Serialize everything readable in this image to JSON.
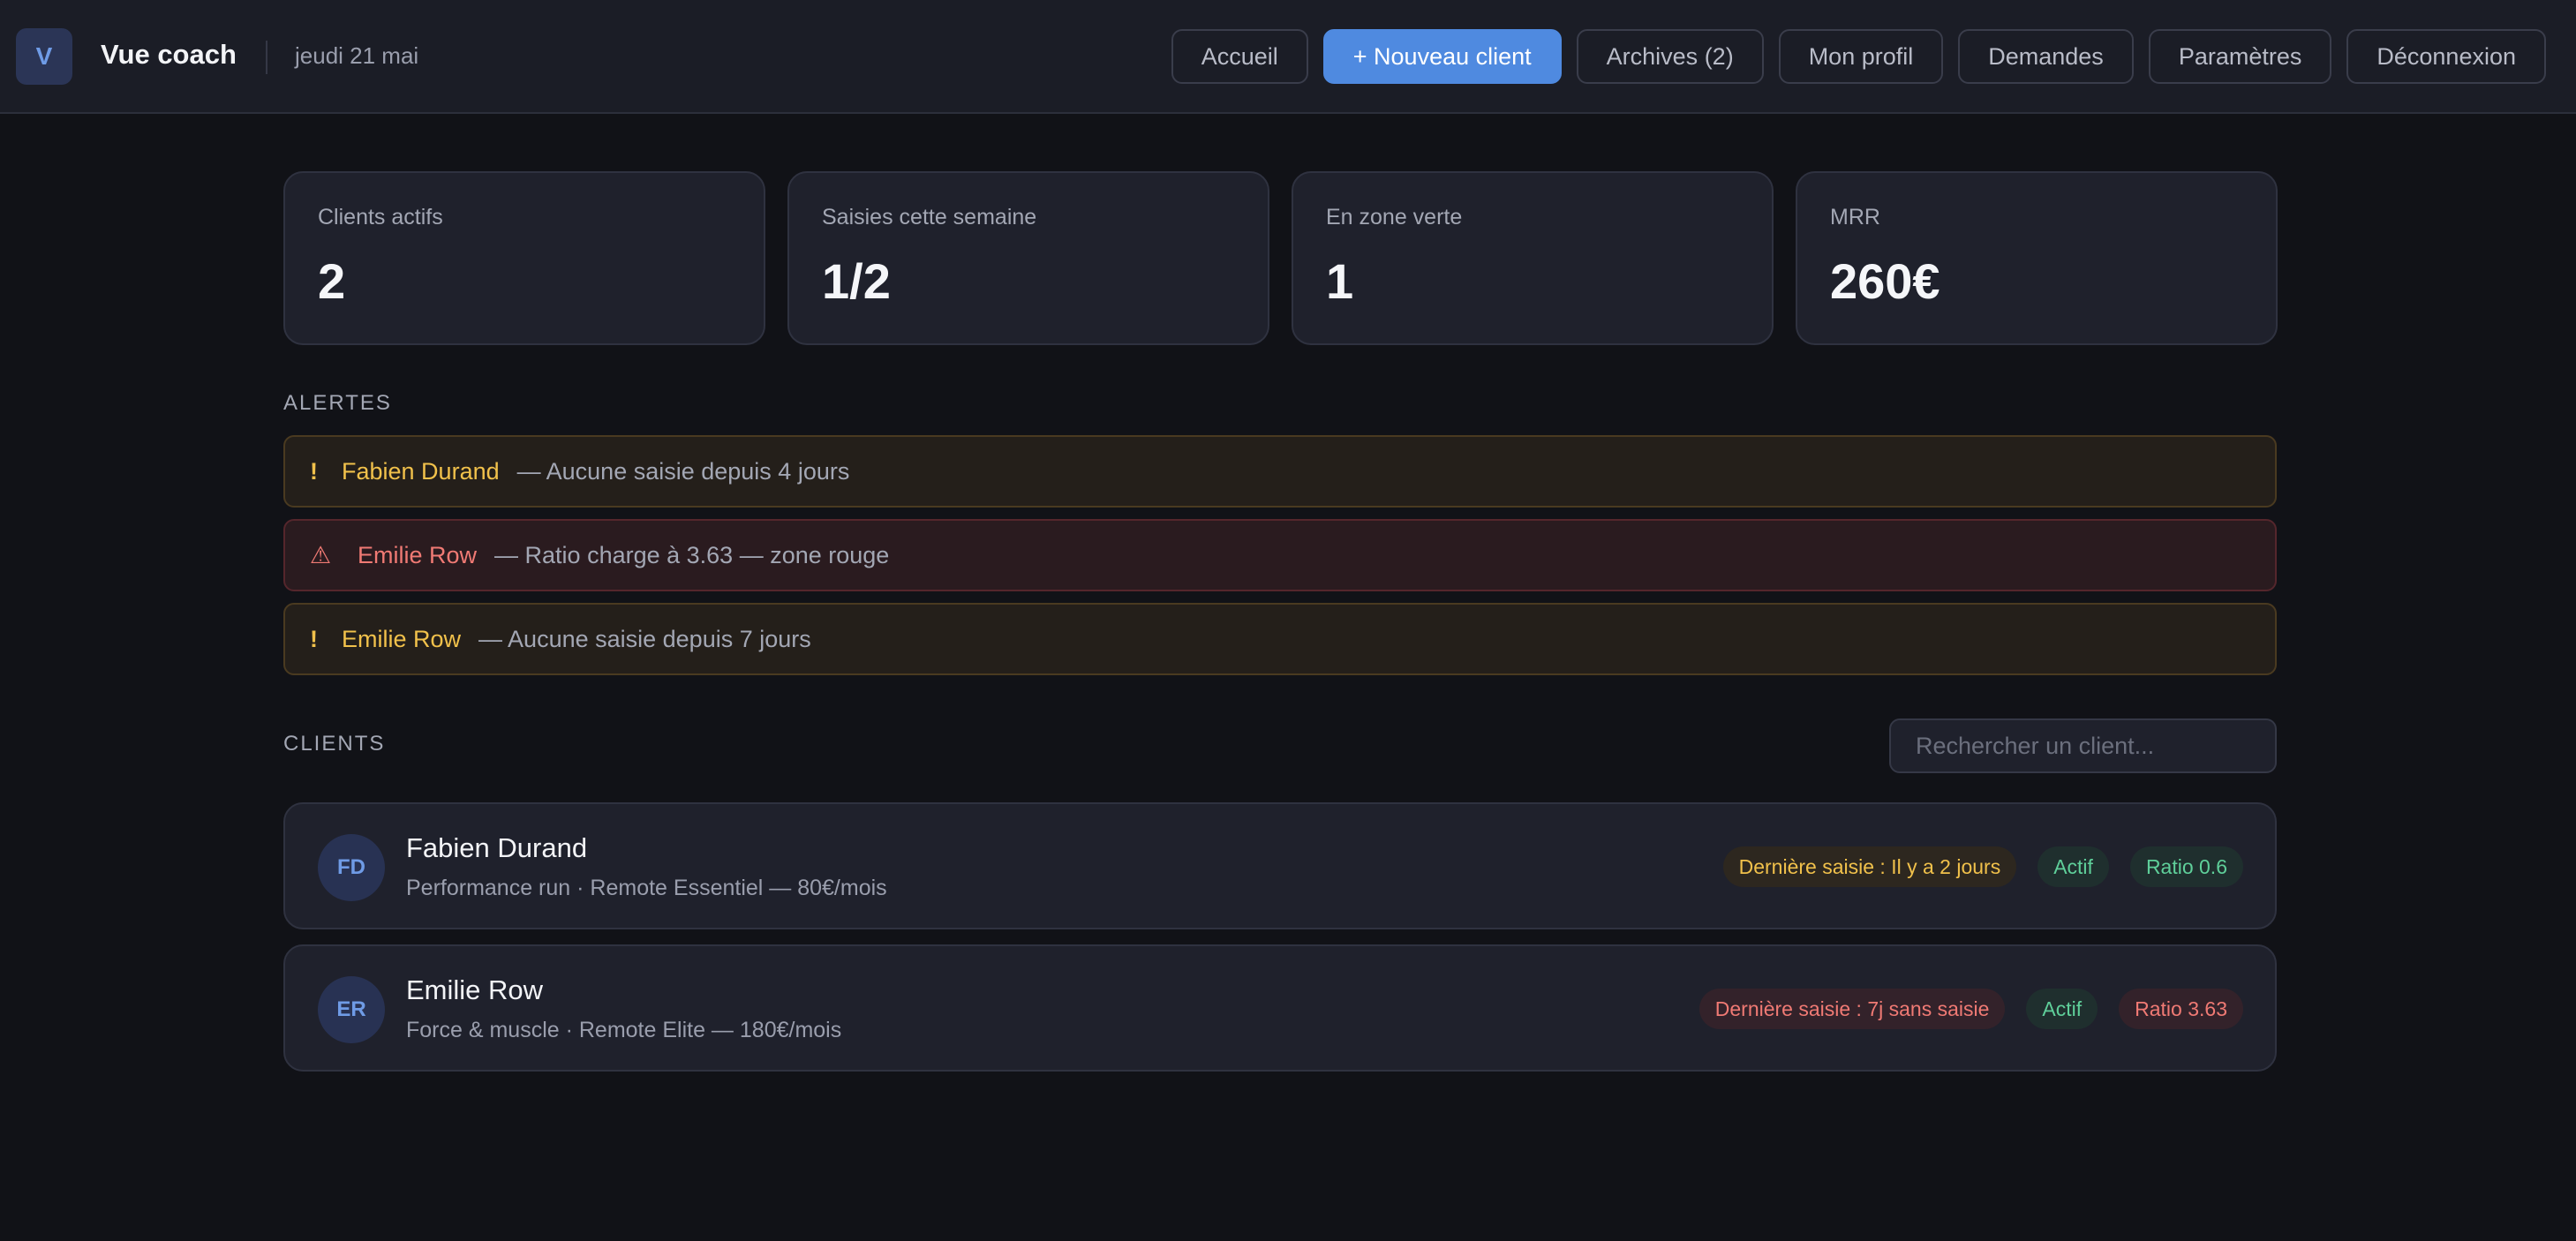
{
  "header": {
    "logo_letter": "V",
    "title": "Vue coach",
    "date": "jeudi 21 mai",
    "nav": [
      {
        "label": "Accueil"
      },
      {
        "label": "+ Nouveau client"
      },
      {
        "label": "Archives (2)"
      },
      {
        "label": "Mon profil"
      },
      {
        "label": "Demandes"
      },
      {
        "label": "Paramètres"
      },
      {
        "label": "Déconnexion"
      }
    ]
  },
  "stats": [
    {
      "label": "Clients actifs",
      "value": "2"
    },
    {
      "label": "Saisies cette semaine",
      "value": "1/2"
    },
    {
      "label": "En zone verte",
      "value": "1"
    },
    {
      "label": "MRR",
      "value": "260€"
    }
  ],
  "alerts": {
    "title": "ALERTES",
    "items": [
      {
        "severity": "warning",
        "icon": "!",
        "name": "Fabien Durand",
        "text": "— Aucune saisie depuis 4 jours"
      },
      {
        "severity": "danger",
        "icon": "⚠",
        "name": "Emilie Row",
        "text": "— Ratio charge à 3.63 — zone rouge"
      },
      {
        "severity": "warning",
        "icon": "!",
        "name": "Emilie Row",
        "text": "— Aucune saisie depuis 7 jours"
      }
    ]
  },
  "clients": {
    "title": "CLIENTS",
    "search_placeholder": "Rechercher un client...",
    "items": [
      {
        "initials": "FD",
        "name": "Fabien Durand",
        "subtitle": "Performance run · Remote Essentiel — 80€/mois",
        "last_entry": "Dernière saisie : Il y a 2 jours",
        "status": "Actif",
        "ratio": "Ratio 0.6"
      },
      {
        "initials": "ER",
        "name": "Emilie Row",
        "subtitle": "Force & muscle · Remote Elite — 180€/mois",
        "last_entry": "Dernière saisie : 7j sans saisie",
        "status": "Actif",
        "ratio": "Ratio 3.63"
      }
    ]
  },
  "colors": {
    "accent": "#4f8ae0",
    "warning": "#f1c14b",
    "danger": "#f07a74",
    "success": "#5fcf9a",
    "background": "#111217"
  }
}
